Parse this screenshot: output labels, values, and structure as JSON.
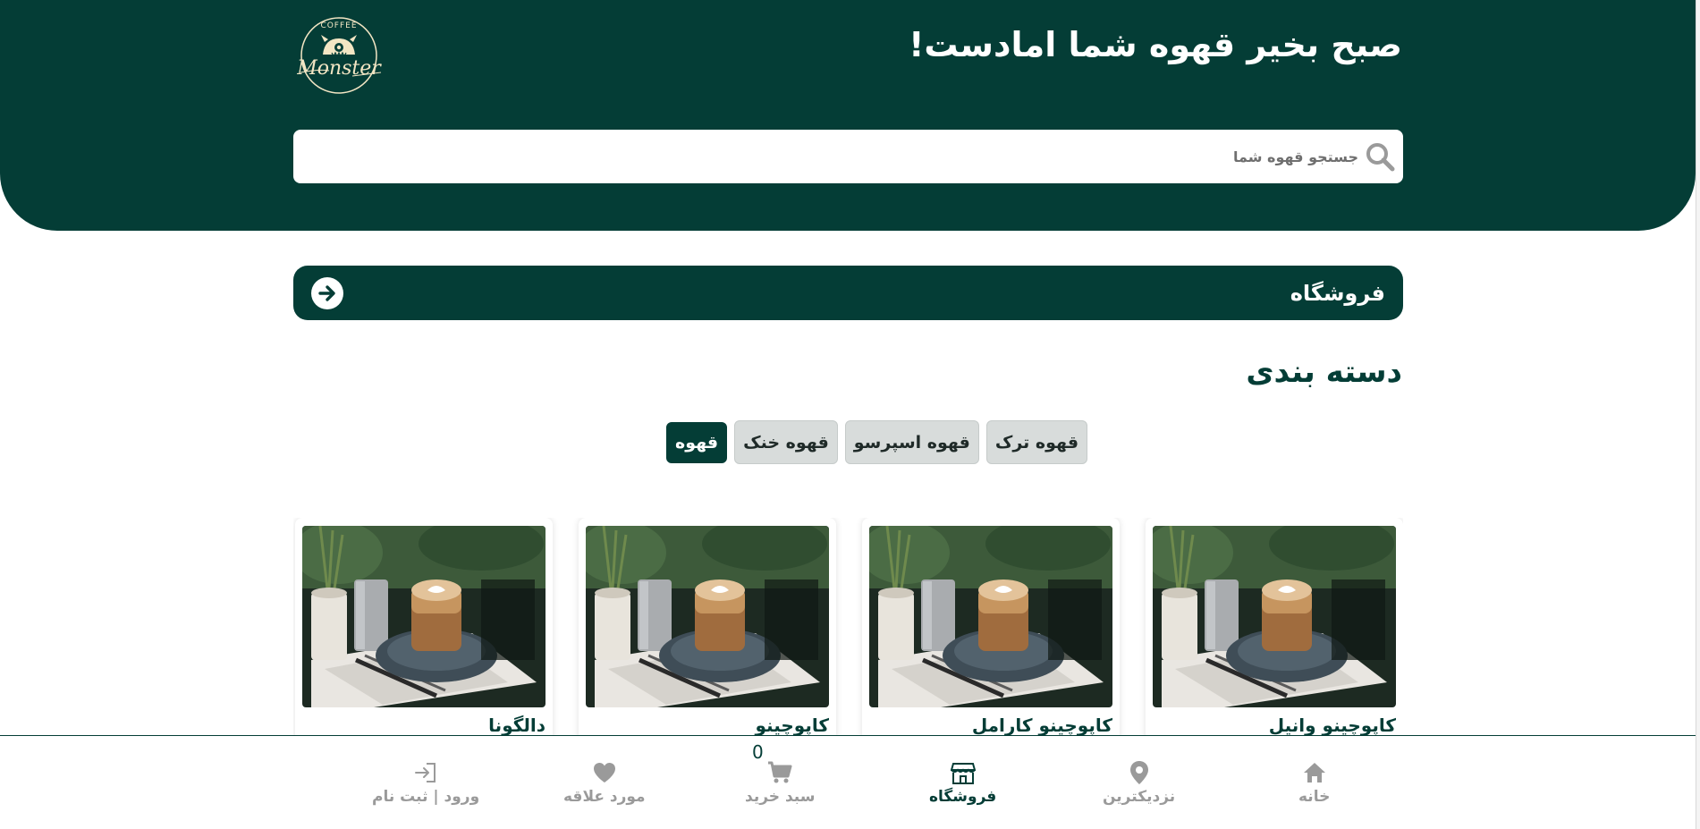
{
  "header": {
    "greeting": "صبح بخیر قهوه شما امادست!",
    "logo_top_text": "COFFEE",
    "logo_script_text": "Monster"
  },
  "search": {
    "placeholder": "جستجو قهوه شما",
    "value": ""
  },
  "shop_bar": {
    "title": "فروشگاه"
  },
  "categories": {
    "title": "دسته بندی",
    "chips": [
      {
        "label": "قهوه",
        "active": true
      },
      {
        "label": "قهوه خنک",
        "active": false
      },
      {
        "label": "قهوه اسپرسو",
        "active": false
      },
      {
        "label": "قهوه ترک",
        "active": false
      }
    ]
  },
  "products": [
    {
      "name": "دالگونا"
    },
    {
      "name": "کاپوچینو"
    },
    {
      "name": "کاپوچینو کارامل"
    },
    {
      "name": "کاپوچینو وانیل"
    }
  ],
  "bottom_nav": {
    "cart_count": "0",
    "items": [
      {
        "label": "خانه",
        "icon": "home-icon"
      },
      {
        "label": "نزدیکترین",
        "icon": "map-pin-icon"
      },
      {
        "label": "فروشگاه",
        "icon": "store-icon",
        "active": true
      },
      {
        "label": "سبد خرید",
        "icon": "cart-icon"
      },
      {
        "label": "مورد علاقه",
        "icon": "heart-icon"
      },
      {
        "label": "ورود | ثبت نام",
        "icon": "login-icon"
      }
    ]
  },
  "colors": {
    "brand": "#043d36",
    "chip_bg": "#d8dcdb",
    "nav_inactive": "#9a9a9a",
    "logo_cream": "#f3e6c4"
  }
}
